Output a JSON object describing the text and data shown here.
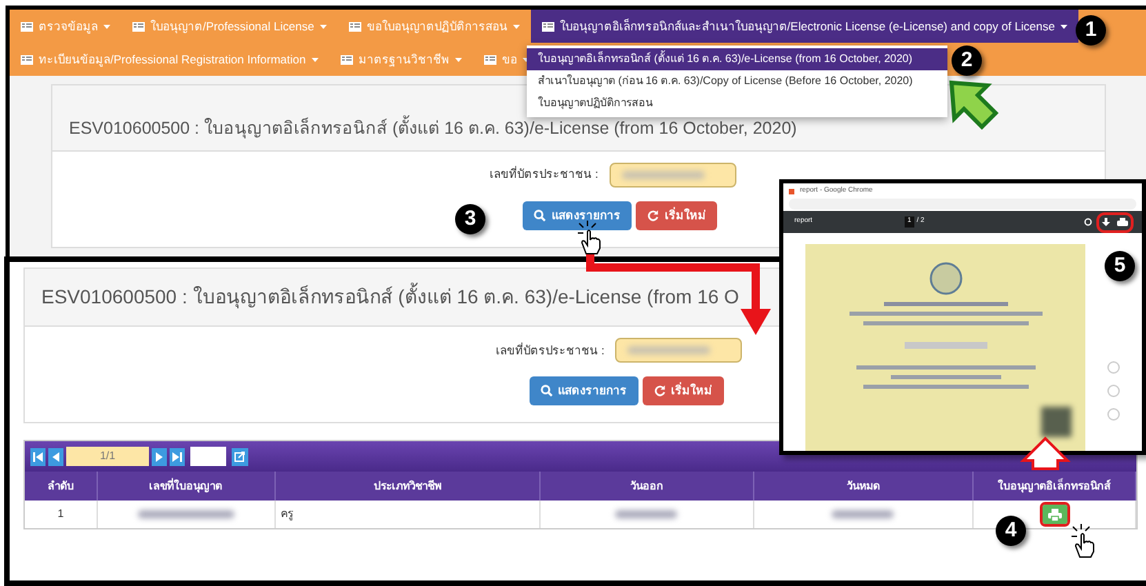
{
  "nav": {
    "row_1": [
      {
        "label": "ตรวจข้อมูล",
        "selected": false
      },
      {
        "label": "ใบอนุญาต/Professional License",
        "selected": false
      },
      {
        "label": "ขอใบอนุญาตปฏิบัติการสอน",
        "selected": false
      },
      {
        "label": "ใบอนุญาตอิเล็กทรอนิกส์และสำเนาใบอนุญาต/Electronic License (e-License) and copy of License",
        "selected": true
      }
    ],
    "row_2": [
      {
        "label": "ทะเบียนข้อมูล/Professional Registration Information",
        "selected": false
      },
      {
        "label": "มาตรฐานวิชาชีพ",
        "selected": false
      },
      {
        "label": "ขอ",
        "selected": false
      }
    ]
  },
  "dropdown": [
    {
      "label": "ใบอนุญาตอิเล็กทรอนิกส์ (ตั้งแต่ 16 ต.ค. 63)/e-License (from 16 October, 2020)",
      "selected": true
    },
    {
      "label": "สำเนาใบอนุญาต (ก่อน 16 ต.ค. 63)/Copy of License (Before 16 October, 2020)",
      "selected": false
    },
    {
      "label": "ใบอนุญาตปฏิบัติการสอน",
      "selected": false
    }
  ],
  "top_screen": {
    "title": "ESV010600500 : ใบอนุญาตอิเล็กทรอนิกส์ (ตั้งแต่ 16 ต.ค. 63)/e-License (from 16 October, 2020)",
    "id_label": "เลขที่บัตรประชาชน :",
    "search_button": "แสดงรายการ",
    "reset_button": "เริ่มใหม่"
  },
  "bottom_screen": {
    "title": "ESV010600500 : ใบอนุญาตอิเล็กทรอนิกส์ (ตั้งแต่ 16 ต.ค. 63)/e-License (from 16 O",
    "id_label": "เลขที่บัตรประชาชน :",
    "search_button": "แสดงรายการ",
    "reset_button": "เริ่มใหม่",
    "pager": "1/1",
    "table": {
      "columns": [
        "ลำดับ",
        "เลขที่ใบอนุญาต",
        "ประเภทวิชาชีพ",
        "วันออก",
        "วันหมด",
        "ใบอนุญาตอิเล็กทรอนิกส์"
      ],
      "rows": [
        {
          "number": "1",
          "profession": "ครู"
        }
      ]
    }
  },
  "popup": {
    "window_title": "report - Google Chrome",
    "viewer_title": "report",
    "page": "1",
    "page_count": "/ 2"
  },
  "steps": [
    "1",
    "2",
    "3",
    "4",
    "5"
  ]
}
